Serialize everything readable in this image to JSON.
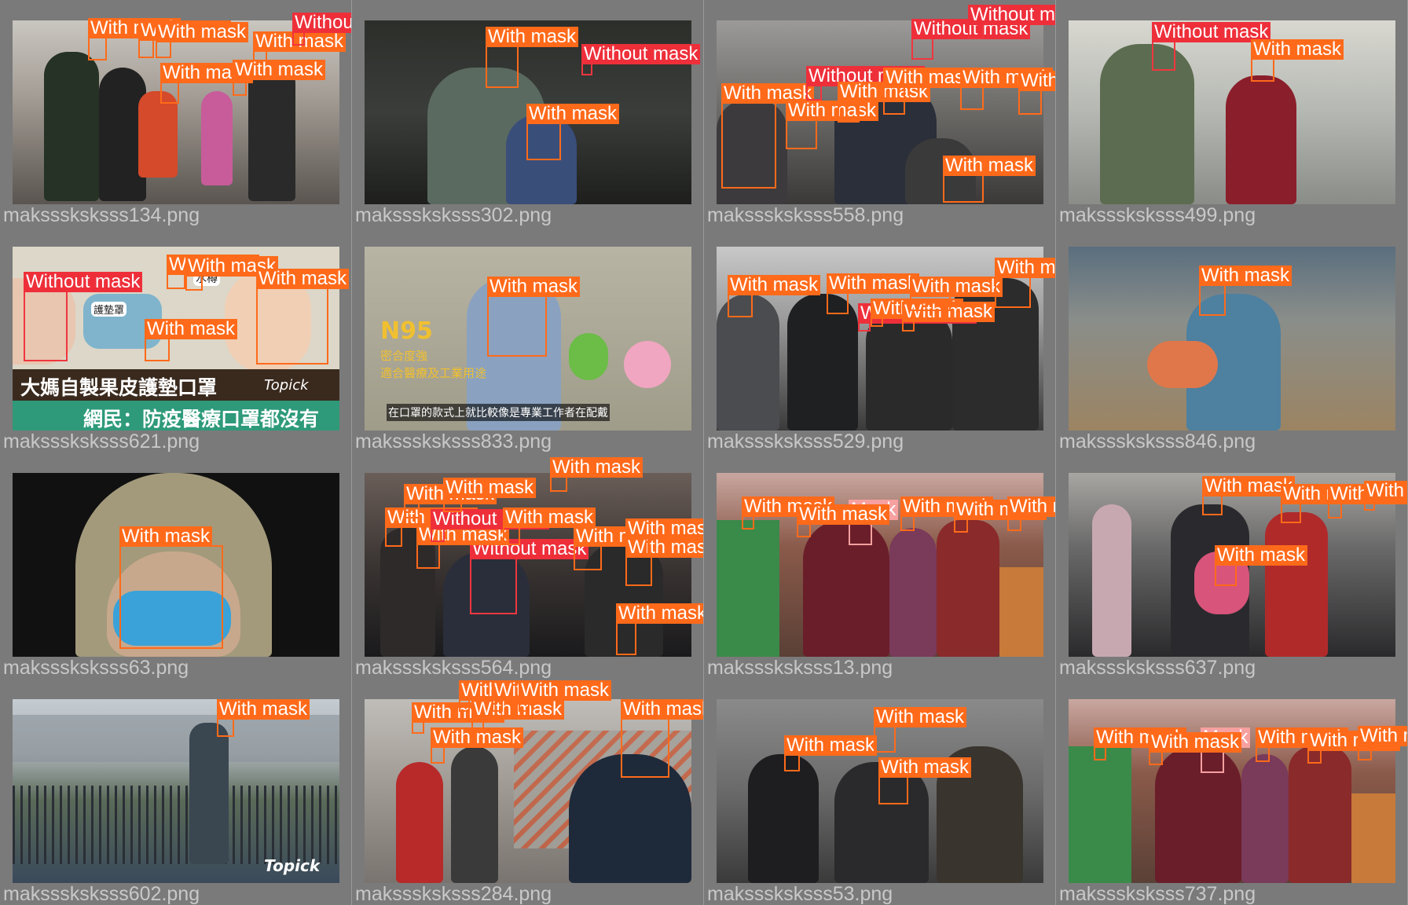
{
  "labels": {
    "with_mask": "With mask",
    "without_mask": "Without mask",
    "mask": "Mask"
  },
  "colors": {
    "with_mask": "#ff6a1a",
    "without_mask": "#ee2f3a",
    "mask_weared_incorrect": "#f7a0a0",
    "background": "#7a7a7a"
  },
  "tiles": [
    {
      "filename": "maksssksksss134.png"
    },
    {
      "filename": "maksssksksss302.png"
    },
    {
      "filename": "maksssksksss558.png"
    },
    {
      "filename": "maksssksksss499.png"
    },
    {
      "filename": "maksssksksss621.png",
      "overlay_text": [
        "護墊罩",
        "水樽",
        "陳皮",
        "大媽自製果皮護墊口罩",
        "網民：防疫醫療口罩都沒有",
        "Topick"
      ]
    },
    {
      "filename": "maksssksksss833.png",
      "overlay_text": [
        "N95",
        "密合度強",
        "適合醫療及工業用途",
        "在口罩的款式上就比較像是專業工作者在配戴"
      ]
    },
    {
      "filename": "maksssksksss529.png"
    },
    {
      "filename": "maksssksksss846.png"
    },
    {
      "filename": "maksssksksss63.png"
    },
    {
      "filename": "maksssksksss564.png"
    },
    {
      "filename": "maksssksksss13.png"
    },
    {
      "filename": "maksssksksss637.png"
    },
    {
      "filename": "maksssksksss602.png",
      "overlay_text": [
        "Topick"
      ]
    },
    {
      "filename": "maksssksksss284.png"
    },
    {
      "filename": "maksssksksss53.png"
    },
    {
      "filename": "maksssksksss737.png"
    }
  ]
}
